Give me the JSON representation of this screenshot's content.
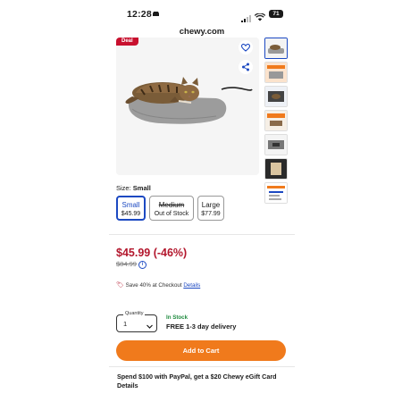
{
  "status_bar": {
    "time": "12:28",
    "battery": "71"
  },
  "browser": {
    "url": "chewy.com"
  },
  "product": {
    "deal_badge": "Deal",
    "image_alt": "Cat lying on a gray heated pet pad"
  },
  "size": {
    "label": "Size:",
    "selected": "Small",
    "options": [
      {
        "name": "Small",
        "detail": "$45.99",
        "state": "selected"
      },
      {
        "name": "Medium",
        "detail": "Out of Stock",
        "state": "out-of-stock"
      },
      {
        "name": "Large",
        "detail": "$77.99",
        "state": "available"
      }
    ]
  },
  "pricing": {
    "price": "$45.99 (-46%)",
    "was_price": "$84.99"
  },
  "promo": {
    "text": "Save 40% at Checkout",
    "link": "Details"
  },
  "purchase": {
    "quantity_label": "Quantity",
    "quantity_value": "1",
    "stock_status": "In Stock",
    "delivery": "FREE 1-3 day delivery",
    "add_to_cart": "Add to Cart"
  },
  "offer": {
    "text": "Spend $100 with PayPal, get a $20 Chewy eGift Card",
    "link": "Details"
  },
  "colors": {
    "accent_blue": "#1c49c2",
    "sale_red": "#b3172d",
    "cart_orange": "#f07a1c",
    "stock_green": "#1e8a3e"
  }
}
